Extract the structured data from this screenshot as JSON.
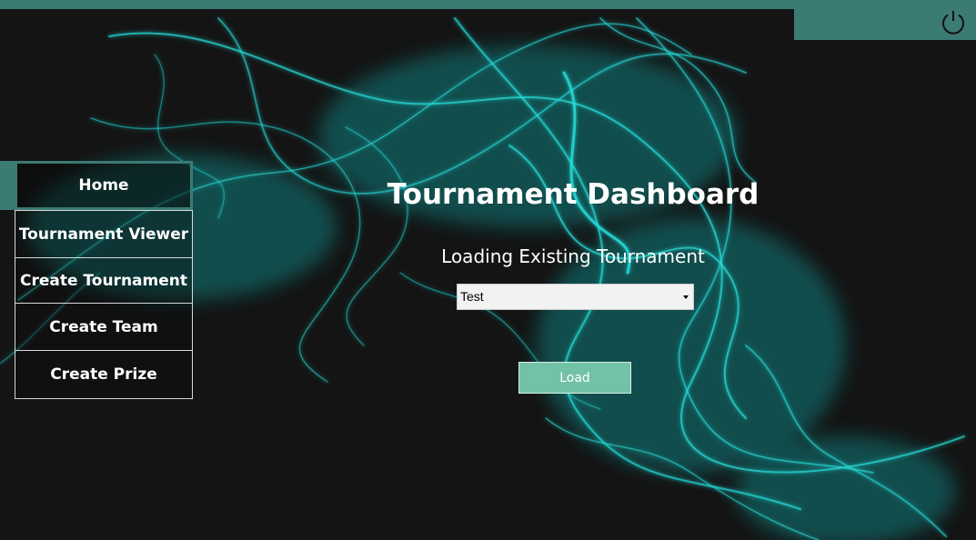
{
  "app": {
    "title": "Tournament Dashboard",
    "accent_color": "#3c7a74",
    "button_color": "#72c2a7",
    "background_color": "#141414"
  },
  "toolbar": {
    "power_icon": "power-icon"
  },
  "sidebar": {
    "items": [
      {
        "label": "Home",
        "active": true
      },
      {
        "label": "Tournament Viewer",
        "active": false
      },
      {
        "label": "Create Tournament",
        "active": false
      },
      {
        "label": "Create Team",
        "active": false
      },
      {
        "label": "Create Prize",
        "active": false
      }
    ]
  },
  "main": {
    "title": "Tournament Dashboard",
    "subtitle": "Loading Existing Tournament",
    "tournament_select": {
      "selected": "Test"
    },
    "load_label": "Load"
  }
}
